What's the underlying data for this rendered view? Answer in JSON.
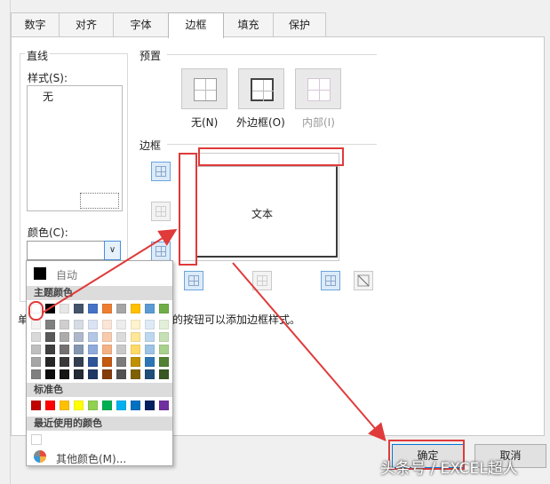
{
  "tabs": [
    "数字",
    "对齐",
    "字体",
    "边框",
    "填充",
    "保护"
  ],
  "line_group": {
    "title": "直线",
    "style_label": "样式(S):",
    "style_none": "无",
    "color_label": "颜色(C):",
    "dropdown_arrow": "∨"
  },
  "presets": {
    "title": "预置",
    "items": [
      "无(N)",
      "外边框(O)",
      "内部(I)"
    ]
  },
  "border": {
    "title": "边框",
    "preview_text": "文本"
  },
  "hint": {
    "left": "单",
    "right": "的按钮可以添加边框样式。"
  },
  "palette": {
    "auto_label": "自动",
    "theme_header": "主题颜色",
    "standard_header": "标准色",
    "recent_header": "最近使用的颜色",
    "more_label": "其他颜色(M)...",
    "theme_top": [
      "#ffffff",
      "#000000",
      "#e7e6e6",
      "#44546a",
      "#4472c4",
      "#ed7d31",
      "#a5a5a5",
      "#ffc000",
      "#5b9bd5",
      "#70ad47"
    ],
    "theme_shades": [
      [
        "#f2f2f2",
        "#7f7f7f",
        "#d0cece",
        "#d6dce4",
        "#dae3f3",
        "#fbe5d6",
        "#ededed",
        "#fff2cc",
        "#deebf7",
        "#e2f0d9"
      ],
      [
        "#d9d9d9",
        "#595959",
        "#aeabab",
        "#adb9ca",
        "#b4c7e7",
        "#f8cbad",
        "#dbdbdb",
        "#ffe699",
        "#bdd7ee",
        "#c5e0b4"
      ],
      [
        "#bfbfbf",
        "#3f3f3f",
        "#757171",
        "#8497b0",
        "#8faadc",
        "#f4b183",
        "#c9c9c9",
        "#ffd966",
        "#9dc3e6",
        "#a9d18e"
      ],
      [
        "#a6a6a6",
        "#262626",
        "#3a3838",
        "#333f50",
        "#2f5597",
        "#c55a11",
        "#7b7b7b",
        "#bf9000",
        "#2e75b6",
        "#538135"
      ],
      [
        "#7f7f7f",
        "#0d0d0d",
        "#171616",
        "#222a35",
        "#1f3864",
        "#843c0b",
        "#525252",
        "#7f6000",
        "#1f4e79",
        "#385723"
      ]
    ],
    "standard": [
      "#c00000",
      "#ff0000",
      "#ffc000",
      "#ffff00",
      "#92d050",
      "#00b050",
      "#00b0f0",
      "#0070c0",
      "#002060",
      "#7030a0"
    ]
  },
  "buttons": {
    "ok": "确定",
    "cancel": "取消"
  },
  "watermark": "头条号 / EXCEL超人"
}
